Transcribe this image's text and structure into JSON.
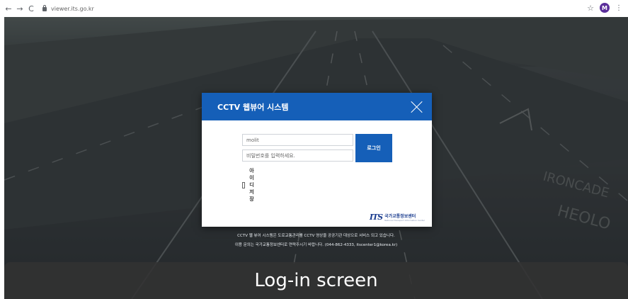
{
  "browser": {
    "url": "viewer.its.go.kr",
    "avatar_letter": "M"
  },
  "modal": {
    "title": "CCTV 웹뷰어 시스템",
    "id_value": "molit",
    "password_placeholder": "비밀번호를 입력하세요.",
    "login_label": "로그인",
    "remember_label": "아이디 저장",
    "org_name": "국가교통정보센터",
    "org_sub": "National Transport Information Center",
    "logo_mark": "ITS"
  },
  "notice": {
    "line1": "CCTV 웹 뷰어 시스템은 도로교통관리를 CCTV 영상을 공공기관 대상으로 서비스 되고 있습니다.",
    "line2": "이용 문의는 국가교통정보센터로 연락주시기 바랍니다. (044-862-4333, itscenter1@korea.kr)"
  },
  "caption": "Log-in screen",
  "colors": {
    "accent": "#155fb8",
    "overlay": "#0a0e14"
  },
  "icons": [
    "back-icon",
    "forward-icon",
    "reload-icon",
    "lock-icon",
    "star-icon",
    "menu-icon",
    "close-icon"
  ]
}
